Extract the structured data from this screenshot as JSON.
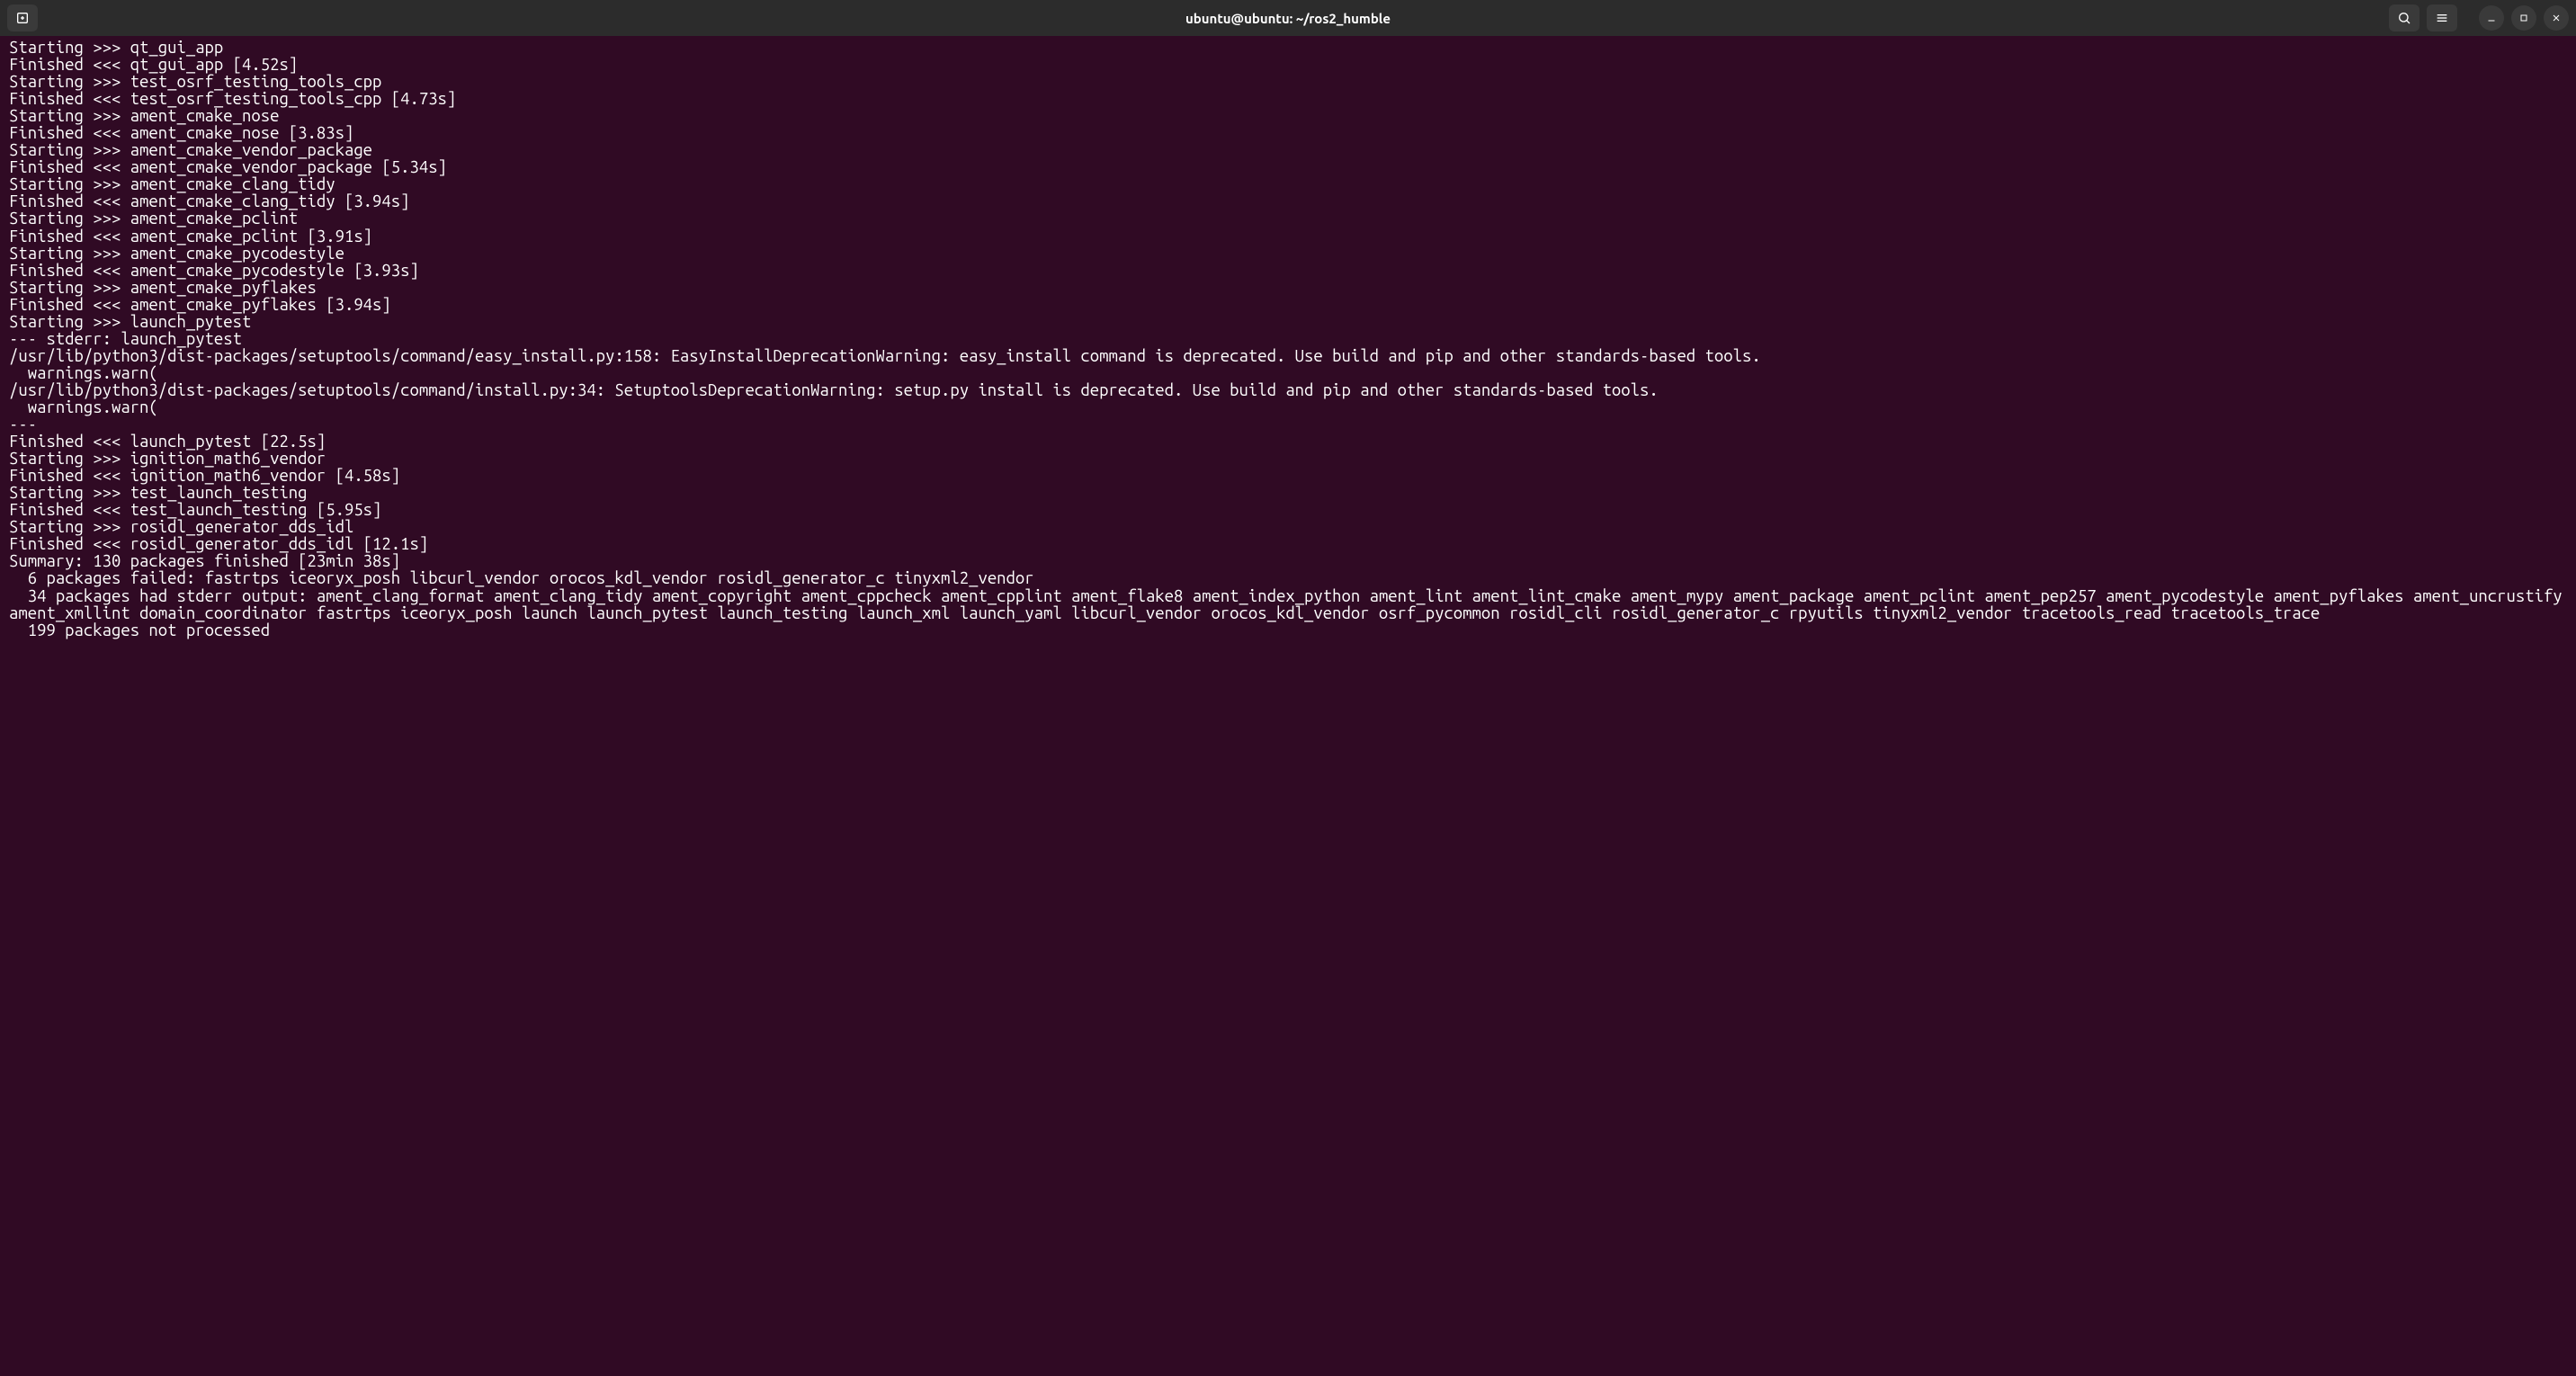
{
  "titlebar": {
    "title": "ubuntu@ubuntu: ~/ros2_humble"
  },
  "terminal": {
    "lines": [
      "Starting >>> qt_gui_app",
      "Finished <<< qt_gui_app [4.52s]",
      "Starting >>> test_osrf_testing_tools_cpp",
      "Finished <<< test_osrf_testing_tools_cpp [4.73s]",
      "Starting >>> ament_cmake_nose",
      "Finished <<< ament_cmake_nose [3.83s]",
      "Starting >>> ament_cmake_vendor_package",
      "Finished <<< ament_cmake_vendor_package [5.34s]",
      "Starting >>> ament_cmake_clang_tidy",
      "Finished <<< ament_cmake_clang_tidy [3.94s]",
      "Starting >>> ament_cmake_pclint",
      "Finished <<< ament_cmake_pclint [3.91s]",
      "Starting >>> ament_cmake_pycodestyle",
      "Finished <<< ament_cmake_pycodestyle [3.93s]",
      "Starting >>> ament_cmake_pyflakes",
      "Finished <<< ament_cmake_pyflakes [3.94s]",
      "Starting >>> launch_pytest",
      "--- stderr: launch_pytest",
      "/usr/lib/python3/dist-packages/setuptools/command/easy_install.py:158: EasyInstallDeprecationWarning: easy_install command is deprecated. Use build and pip and other standards-based tools.",
      "  warnings.warn(",
      "/usr/lib/python3/dist-packages/setuptools/command/install.py:34: SetuptoolsDeprecationWarning: setup.py install is deprecated. Use build and pip and other standards-based tools.",
      "  warnings.warn(",
      "---",
      "Finished <<< launch_pytest [22.5s]",
      "Starting >>> ignition_math6_vendor",
      "Finished <<< ignition_math6_vendor [4.58s]",
      "Starting >>> test_launch_testing",
      "Finished <<< test_launch_testing [5.95s]",
      "Starting >>> rosidl_generator_dds_idl",
      "Finished <<< rosidl_generator_dds_idl [12.1s]",
      "",
      "Summary: 130 packages finished [23min 38s]",
      "  6 packages failed: fastrtps iceoryx_posh libcurl_vendor orocos_kdl_vendor rosidl_generator_c tinyxml2_vendor",
      "  34 packages had stderr output: ament_clang_format ament_clang_tidy ament_copyright ament_cppcheck ament_cpplint ament_flake8 ament_index_python ament_lint ament_lint_cmake ament_mypy ament_package ament_pclint ament_pep257 ament_pycodestyle ament_pyflakes ament_uncrustify ament_xmllint domain_coordinator fastrtps iceoryx_posh launch launch_pytest launch_testing launch_xml launch_yaml libcurl_vendor orocos_kdl_vendor osrf_pycommon rosidl_cli rosidl_generator_c rpyutils tinyxml2_vendor tracetools_read tracetools_trace",
      "  199 packages not processed"
    ]
  }
}
